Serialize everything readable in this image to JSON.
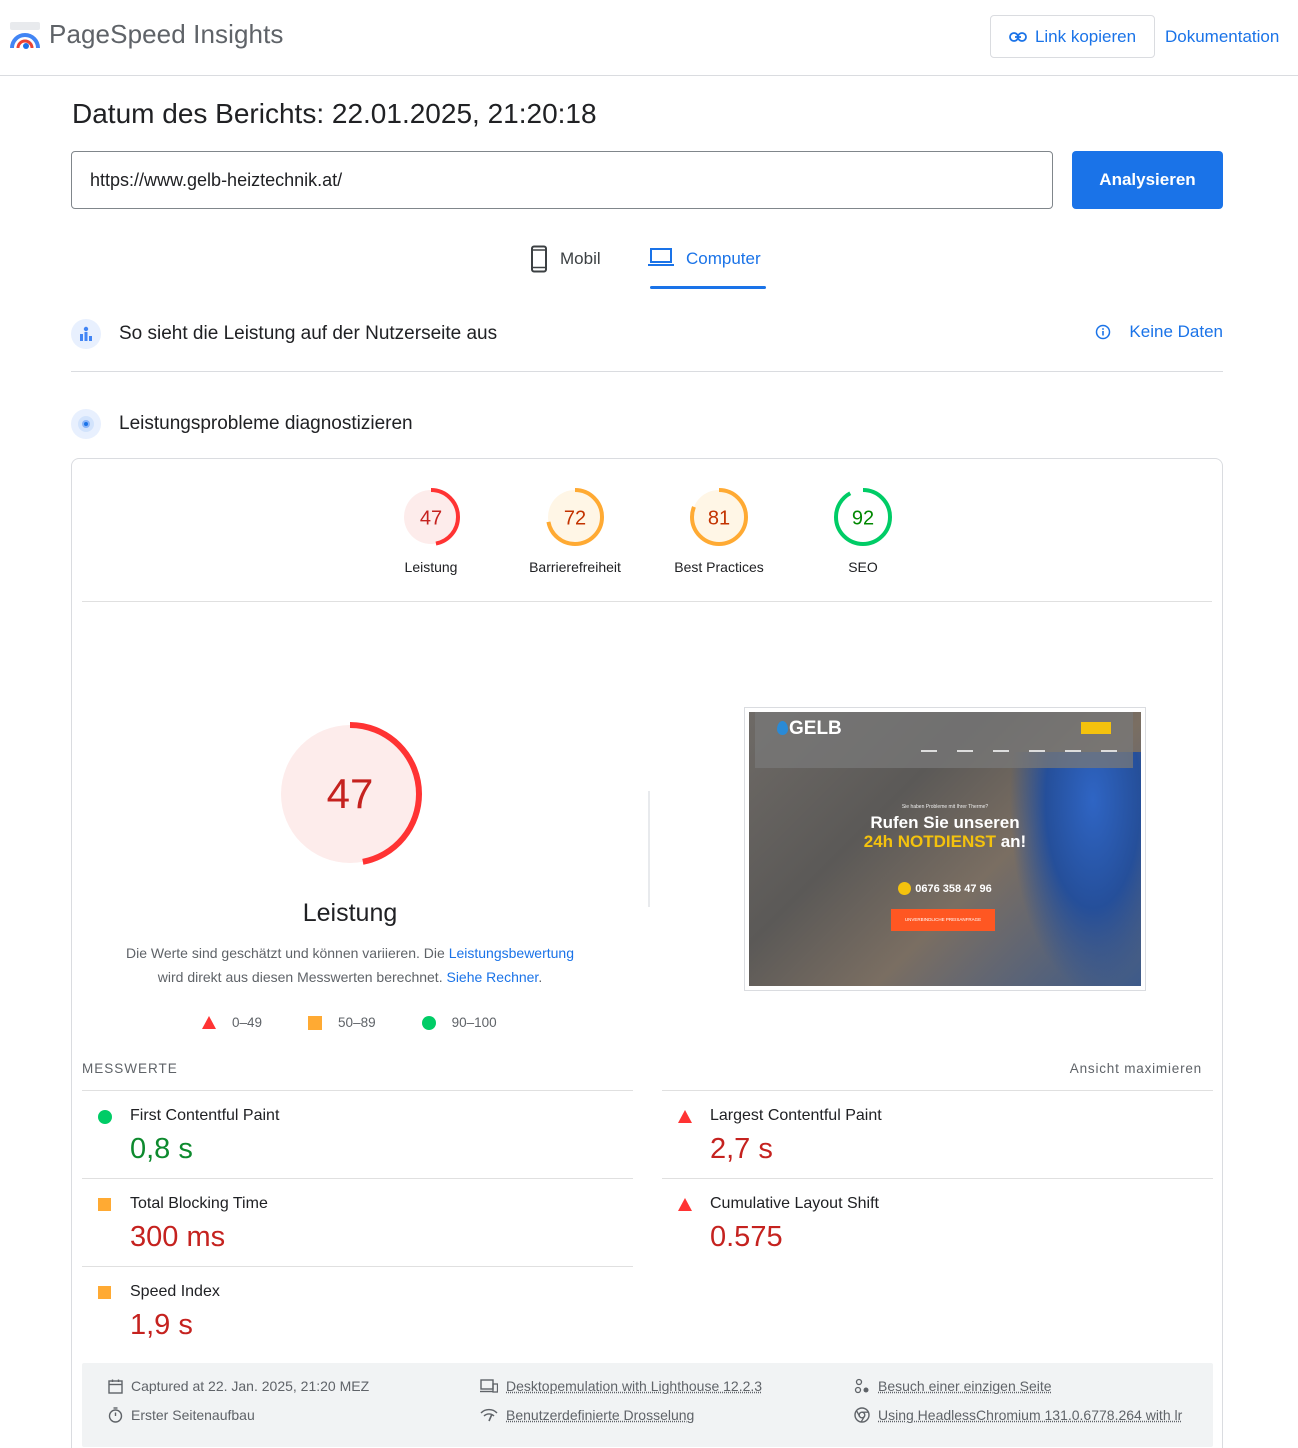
{
  "header": {
    "brand": "PageSpeed Insights",
    "copy_link_label": "Link kopieren",
    "docs_label": "Dokumentation"
  },
  "report_date": "Datum des Berichts: 22.01.2025, 21:20:18",
  "url_input": {
    "value": "https://www.gelb-heiztechnik.at/"
  },
  "analyze_label": "Analysieren",
  "tabs": [
    {
      "label": "Mobil",
      "active": false
    },
    {
      "label": "Computer",
      "active": true
    }
  ],
  "field_section": {
    "title": "So sieht die Leistung auf der Nutzerseite aus",
    "no_data": "Keine Daten"
  },
  "lab_section": {
    "title": "Leistungsprobleme diagnostizieren"
  },
  "scores": [
    {
      "label": "Leistung",
      "value": "47",
      "fraction": 0.47,
      "status": "fail"
    },
    {
      "label": "Barrierefreiheit",
      "value": "72",
      "fraction": 0.72,
      "status": "average"
    },
    {
      "label": "Best Practices",
      "value": "81",
      "fraction": 0.81,
      "status": "average"
    },
    {
      "label": "SEO",
      "value": "92",
      "fraction": 0.92,
      "status": "pass"
    }
  ],
  "performance": {
    "value": "47",
    "fraction": 0.47,
    "label": "Leistung",
    "desc_1": "Die Werte sind geschätzt und können variieren. Die ",
    "desc_link_1": "Leistungsbewertung",
    "desc_2": "wird direkt aus diesen Messwerten berechnet. ",
    "desc_link_2": "Siehe Rechner",
    "desc_end": "."
  },
  "legend": [
    {
      "shape": "triangle",
      "label": "0–49"
    },
    {
      "shape": "square",
      "label": "50–89"
    },
    {
      "shape": "circle",
      "label": "90–100"
    }
  ],
  "screenshot": {
    "logo": "GELB",
    "pre_heading": "Sie haben Probleme mit Ihrer Therme?",
    "heading_1": "Rufen Sie unseren",
    "heading_2_highlight": "24h NOTDIENST",
    "heading_2_rest": " an!",
    "phone": "0676 358 47 96",
    "button": "UNVERBINDLICHE PREISANFRAGE"
  },
  "metrics_header": "MESSWERTE",
  "metrics_expand": "Ansicht maximieren",
  "metrics": [
    {
      "title": "First Contentful Paint",
      "value": "0,8 s",
      "status": "pass"
    },
    {
      "title": "Largest Contentful Paint",
      "value": "2,7 s",
      "status": "fail"
    },
    {
      "title": "Total Blocking Time",
      "value": "300 ms",
      "status": "average"
    },
    {
      "title": "Cumulative Layout Shift",
      "value": "0.575",
      "status": "fail"
    },
    {
      "title": "Speed Index",
      "value": "1,9 s",
      "status": "average"
    }
  ],
  "footer": {
    "captured": "Captured at 22. Jan. 2025, 21:20 MEZ",
    "initial_load": "Erster Seitenaufbau",
    "emulation": "Desktopemulation with Lighthouse 12.2.3",
    "throttling": "Benutzerdefinierte Drosselung",
    "single_visit": "Besuch einer einzigen Seite",
    "browser": "Using HeadlessChromium 131.0.6778.264 with lr"
  },
  "colors": {
    "accent": "#1a73e8",
    "fail": "#ff4e42",
    "average": "#ffa400",
    "pass": "#0cce6b"
  }
}
